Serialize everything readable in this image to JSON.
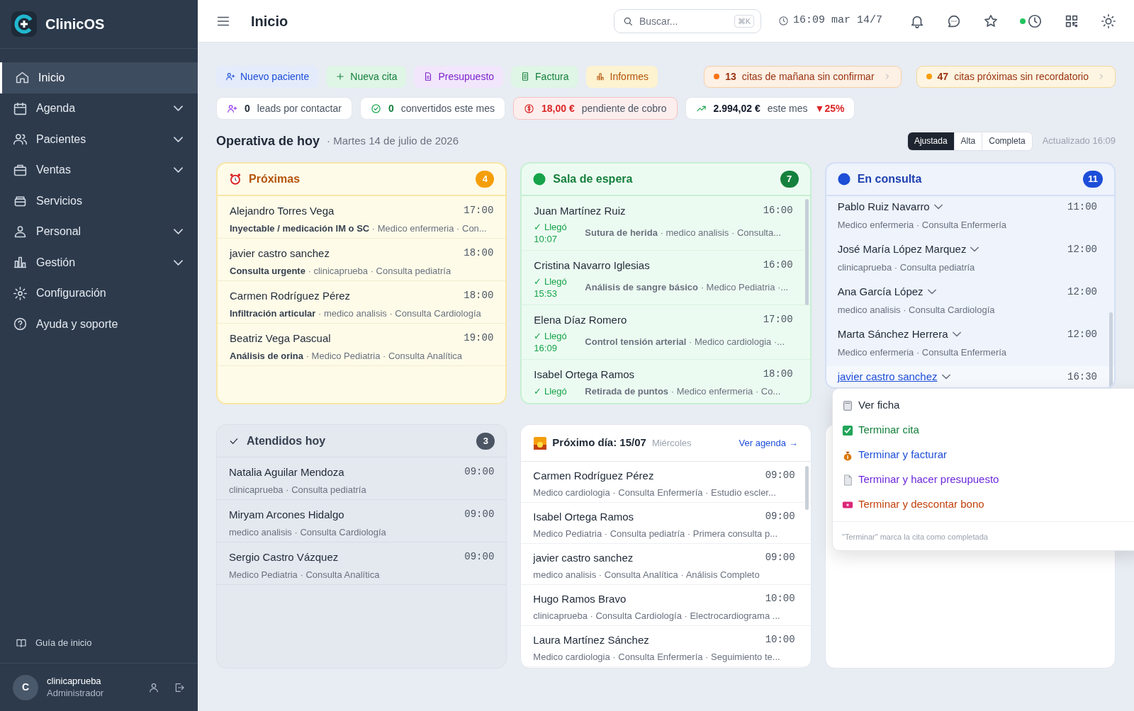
{
  "sidebar": {
    "brand": "ClinicOS",
    "items": [
      {
        "label": "Inicio",
        "selected": true,
        "expandable": false
      },
      {
        "label": "Agenda",
        "selected": false,
        "expandable": true
      },
      {
        "label": "Pacientes",
        "selected": false,
        "expandable": true
      },
      {
        "label": "Ventas",
        "selected": false,
        "expandable": true
      },
      {
        "label": "Servicios",
        "selected": false,
        "expandable": false
      },
      {
        "label": "Personal",
        "selected": false,
        "expandable": true
      },
      {
        "label": "Gestión",
        "selected": false,
        "expandable": true
      },
      {
        "label": "Configuración",
        "selected": false,
        "expandable": false
      },
      {
        "label": "Ayuda y soporte",
        "selected": false,
        "expandable": false
      }
    ],
    "guide": "Guía de inicio",
    "user": {
      "initial": "C",
      "name": "clinicaprueba",
      "role": "Administrador"
    }
  },
  "header": {
    "title": "Inicio",
    "search": {
      "placeholder": "Buscar...",
      "shortcut": "⌘K"
    },
    "clock": "16:09 mar 14/7"
  },
  "actions": [
    {
      "kind": "patient",
      "label": "Nuevo paciente"
    },
    {
      "kind": "appointment",
      "label": "Nueva cita"
    },
    {
      "kind": "budget",
      "label": "Presupuesto"
    },
    {
      "kind": "invoice",
      "label": "Factura"
    },
    {
      "kind": "reports",
      "label": "Informes"
    }
  ],
  "alerts": [
    {
      "kind": "orange",
      "count": "13",
      "label": "citas de mañana sin confirmar"
    },
    {
      "kind": "amber",
      "count": "47",
      "label": "citas próximas sin recordatorio"
    }
  ],
  "stats": [
    {
      "kind": "leads",
      "value": "0",
      "label": "leads por contactar"
    },
    {
      "kind": "converted",
      "value": "0",
      "label": "convertidos este mes"
    },
    {
      "kind": "pending",
      "value": "18,00 €",
      "label": "pendiente de cobro"
    },
    {
      "kind": "revenue",
      "value": "2.994,02 €",
      "label": "este mes",
      "change": "▼25%"
    }
  ],
  "section": {
    "title": "Operativa de hoy",
    "date": "· Martes 14 de julio de 2026",
    "views": [
      {
        "label": "Ajustada",
        "selected": true
      },
      {
        "label": "Alta",
        "selected": false
      },
      {
        "label": "Completa",
        "selected": false
      }
    ],
    "updated": "Actualizado 16:09"
  },
  "upcoming": {
    "title": "Próximas",
    "count": "4",
    "rows": [
      {
        "name": "Alejandro Torres Vega",
        "time": "17:00",
        "detail": "**Inyectable / medicación IM o SC** · Medico enfermeria · Con..."
      },
      {
        "name": "javier castro sanchez",
        "time": "18:00",
        "detail": "**Consulta urgente** · clinicaprueba · Consulta pediatría"
      },
      {
        "name": "Carmen Rodríguez Pérez",
        "time": "18:00",
        "detail": "**Infiltración articular** · medico analisis · Consulta Cardiología"
      },
      {
        "name": "Beatriz Vega Pascual",
        "time": "19:00",
        "detail": "**Análisis de orina** · Medico Pediatria · Consulta Analítica"
      }
    ]
  },
  "waiting": {
    "title": "Sala de espera",
    "count": "7",
    "rows": [
      {
        "name": "Juan Martínez Ruiz",
        "time": "16:00",
        "arrival": "✓ Llegó 10:07",
        "detail": "**Sutura de herida** · medico analisis · Consulta..."
      },
      {
        "name": "Cristina Navarro Iglesias",
        "time": "16:00",
        "arrival": "✓ Llegó 15:53",
        "detail": "**Análisis de sangre básico** · Medico Pediatria ·..."
      },
      {
        "name": "Elena Díaz Romero",
        "time": "17:00",
        "arrival": "✓ Llegó 16:09",
        "detail": "**Control tensión arterial** · Medico cardiologia ·..."
      },
      {
        "name": "Isabel Ortega Ramos",
        "time": "18:00",
        "arrival": "✓ Llegó",
        "detail": "**Retirada de puntos** · Medico enfermeria · Co..."
      }
    ]
  },
  "consulting": {
    "title": "En consulta",
    "count": "11",
    "rows": [
      {
        "name": "Pablo Ruiz Navarro",
        "time": "11:00",
        "detail": "Medico enfermeria · Consulta Enfermería",
        "hovered": false
      },
      {
        "name": "José María López Marquez",
        "time": "12:00",
        "detail": "clinicaprueba · Consulta pediatría",
        "hovered": false
      },
      {
        "name": "Ana García López",
        "time": "12:00",
        "detail": "medico analisis · Consulta Cardiología",
        "hovered": false
      },
      {
        "name": "Marta Sánchez Herrera",
        "time": "12:00",
        "detail": "Medico enfermeria · Consulta Enfermería",
        "hovered": false
      },
      {
        "name": "javier castro sanchez",
        "time": "16:30",
        "hovered": true
      }
    ]
  },
  "menu": {
    "items": [
      {
        "kind": "view",
        "label": "Ver ficha"
      },
      {
        "kind": "finish",
        "label": "Terminar cita"
      },
      {
        "kind": "invoice",
        "label": "Terminar y facturar"
      },
      {
        "kind": "budget",
        "label": "Terminar y hacer presupuesto"
      },
      {
        "kind": "voucher",
        "label": "Terminar y descontar bono"
      }
    ],
    "note": "\"Terminar\" marca la cita como completada"
  },
  "attended": {
    "title": "Atendidos hoy",
    "count": "3",
    "rows": [
      {
        "name": "Natalia Aguilar Mendoza",
        "time": "09:00",
        "detail": "clinicaprueba · Consulta pediatría"
      },
      {
        "name": "Miryam Arcones Hidalgo",
        "time": "09:00",
        "detail": "medico analisis · Consulta Cardiología"
      },
      {
        "name": "Sergio Castro Vázquez",
        "time": "09:00",
        "detail": "Medico Pediatria · Consulta Analítica"
      }
    ]
  },
  "next_day": {
    "title": "Próximo día: 15/07",
    "weekday": "Miércoles",
    "link": "Ver agenda →",
    "rows": [
      {
        "name": "Carmen Rodríguez Pérez",
        "time": "09:00",
        "detail": "Medico cardiologia · Consulta Enfermería · Estudio escler..."
      },
      {
        "name": "Isabel Ortega Ramos",
        "time": "09:00",
        "detail": "Medico Pediatria · Consulta pediatría · Primera consulta p..."
      },
      {
        "name": "javier castro sanchez",
        "time": "09:00",
        "detail": "medico analisis · Consulta Analítica · Análisis Completo"
      },
      {
        "name": "Hugo Ramos Bravo",
        "time": "10:00",
        "detail": "clinicaprueba · Consulta Cardiología · Electrocardiograma ..."
      },
      {
        "name": "Laura Martínez Sánchez",
        "time": "10:00",
        "detail": "Medico cardiologia · Consulta Enfermería · Seguimiento te..."
      }
    ]
  }
}
